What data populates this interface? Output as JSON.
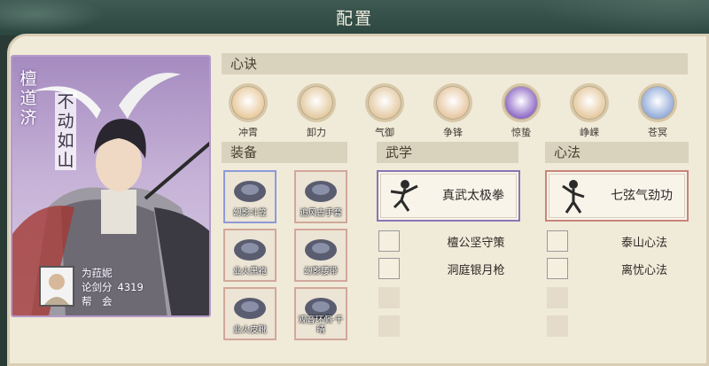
{
  "header": {
    "title": "配置"
  },
  "character": {
    "name": "檀道济",
    "epithet": "不动如山",
    "player": {
      "name": "为菈妮",
      "score_label": "论剑分",
      "score": "4319",
      "guild_label": "帮　会"
    }
  },
  "xinjue": {
    "heading": "心诀",
    "items": [
      {
        "label": "冲霄",
        "color": "#e8c89a"
      },
      {
        "label": "卸力",
        "color": "#e2c79c"
      },
      {
        "label": "气御",
        "color": "#e3c8a0"
      },
      {
        "label": "争锋",
        "color": "#e6c6a0"
      },
      {
        "label": "惊蛰",
        "color": "#8a64c4"
      },
      {
        "label": "峥嵘",
        "color": "#e5c79c"
      },
      {
        "label": "苍冥",
        "color": "#8fa8d8"
      }
    ]
  },
  "equipment": {
    "heading": "装备",
    "items": [
      {
        "label": "幻影斗笠",
        "rarity": "blue"
      },
      {
        "label": "追风古手套",
        "rarity": "red"
      },
      {
        "label": "业火黑袍",
        "rarity": "red"
      },
      {
        "label": "幻影腰带",
        "rarity": "red"
      },
      {
        "label": "业火皮靴",
        "rarity": "red"
      },
      {
        "label": "观音环佩·千晴",
        "rarity": "red"
      }
    ]
  },
  "wuxue": {
    "heading": "武学",
    "main": "真武太极拳",
    "main_color": "#8b74b3",
    "items": [
      "檀公坚守策",
      "洞庭银月枪"
    ]
  },
  "xinfa": {
    "heading": "心法",
    "main": "七弦气劲功",
    "main_color": "#c9847a",
    "items": [
      "泰山心法",
      "离忧心法"
    ]
  }
}
